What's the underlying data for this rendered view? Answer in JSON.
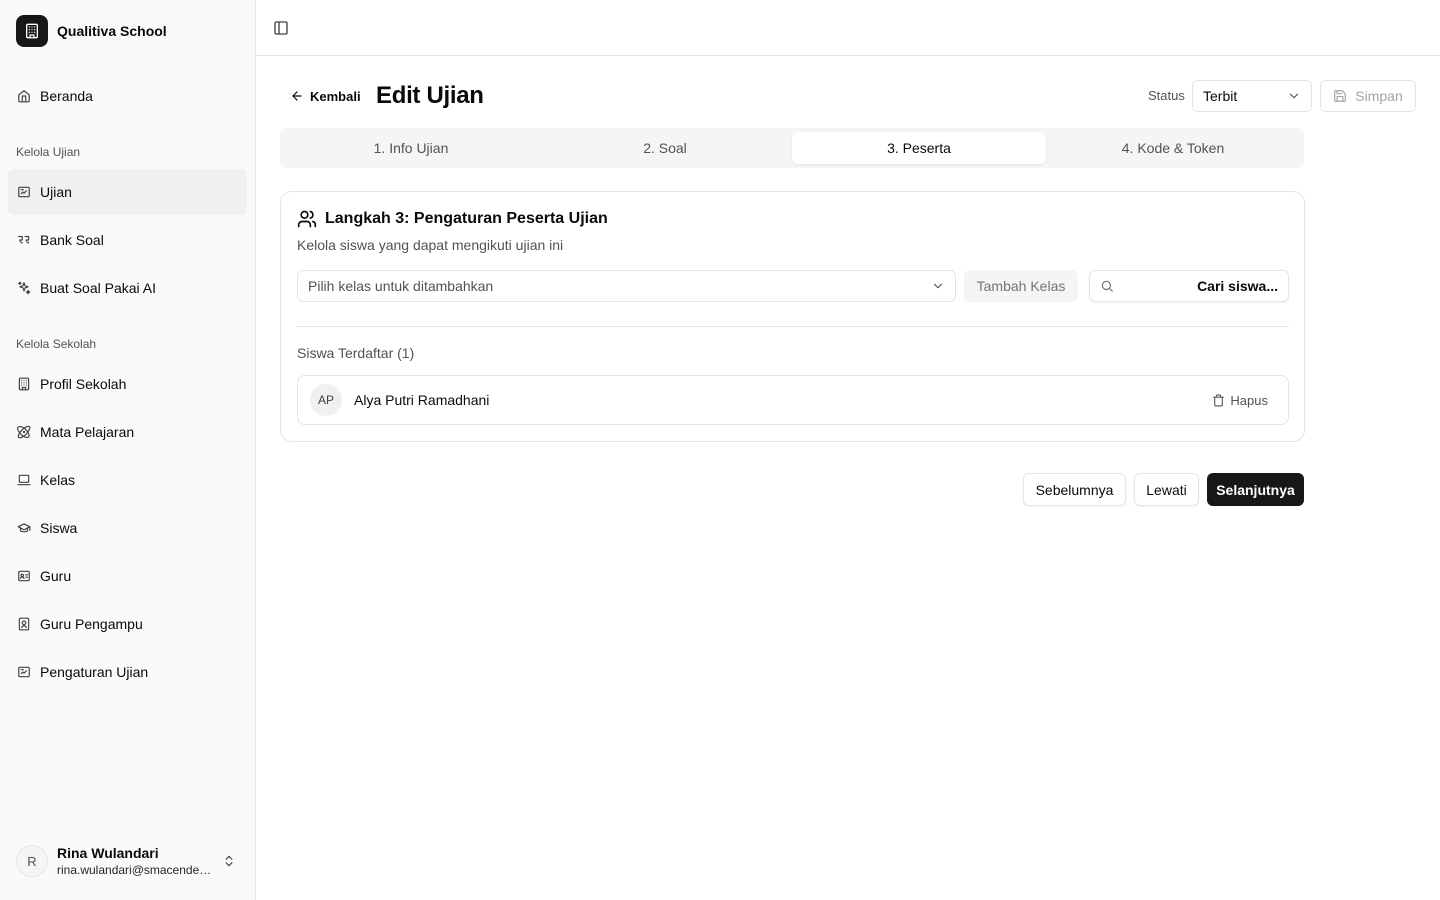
{
  "app": {
    "name": "Qualitiva School"
  },
  "sidebar": {
    "home": {
      "label": "Beranda",
      "icon": "home-icon"
    },
    "section_exam": "Kelola Ujian",
    "exam_items": [
      {
        "label": "Ujian",
        "icon": "exam-icon",
        "active": true
      },
      {
        "label": "Bank Soal",
        "icon": "quote-icon"
      },
      {
        "label": "Buat Soal Pakai AI",
        "icon": "sparkles-icon"
      }
    ],
    "section_school": "Kelola Sekolah",
    "school_items": [
      {
        "label": "Profil Sekolah",
        "icon": "building-icon"
      },
      {
        "label": "Mata Pelajaran",
        "icon": "atom-icon"
      },
      {
        "label": "Kelas",
        "icon": "laptop-icon"
      },
      {
        "label": "Siswa",
        "icon": "graduation-cap-icon"
      },
      {
        "label": "Guru",
        "icon": "id-card-icon"
      },
      {
        "label": "Guru Pengampu",
        "icon": "contact-icon"
      },
      {
        "label": "Pengaturan Ujian",
        "icon": "exam-settings-icon"
      }
    ],
    "user": {
      "initial": "R",
      "name": "Rina Wulandari",
      "email": "rina.wulandari@smacendekia.sch.id"
    }
  },
  "header": {
    "back_label": "Kembali",
    "title": "Edit Ujian",
    "status_label": "Status",
    "status_value": "Terbit",
    "save_label": "Simpan"
  },
  "tabs": [
    {
      "label": "1. Info Ujian",
      "active": false
    },
    {
      "label": "2. Soal",
      "active": false
    },
    {
      "label": "3. Peserta",
      "active": true
    },
    {
      "label": "4. Kode & Token",
      "active": false
    }
  ],
  "participants": {
    "title": "Langkah 3: Pengaturan Peserta Ujian",
    "description": "Kelola siswa yang dapat mengikuti ujian ini",
    "class_placeholder": "Pilih kelas untuk ditambahkan",
    "add_class_label": "Tambah Kelas",
    "search_placeholder": "Cari siswa...",
    "list_title": "Siswa Terdaftar (1)",
    "students": [
      {
        "initials": "AP",
        "name": "Alya Putri Ramadhani",
        "delete_label": "Hapus"
      }
    ]
  },
  "footer": {
    "prev_label": "Sebelumnya",
    "skip_label": "Lewati",
    "next_label": "Selanjutnya"
  },
  "colors": {
    "primary": "#171717",
    "border": "#e5e5e5",
    "muted": "#525252",
    "sidebar_bg": "#fafafa"
  }
}
